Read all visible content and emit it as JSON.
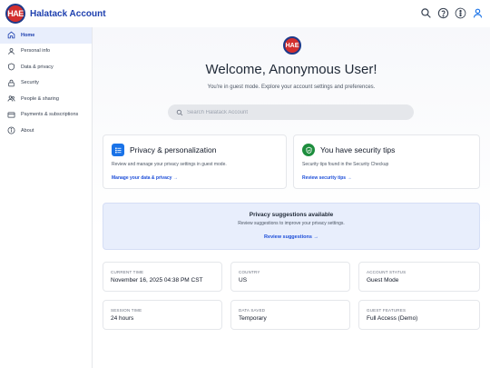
{
  "app": {
    "logo_text": "HAE",
    "name": "Halatack Account"
  },
  "header": {
    "icons": [
      "search-icon",
      "help-icon",
      "more-vert-icon",
      "account-icon"
    ]
  },
  "sidebar": {
    "items": [
      {
        "label": "Home",
        "icon": "home-icon",
        "active": true
      },
      {
        "label": "Personal info",
        "icon": "person-icon"
      },
      {
        "label": "Data & privacy",
        "icon": "shield-icon"
      },
      {
        "label": "Security",
        "icon": "lock-icon"
      },
      {
        "label": "People & sharing",
        "icon": "people-icon"
      },
      {
        "label": "Payments & subscriptions",
        "icon": "card-icon"
      },
      {
        "label": "About",
        "icon": "info-icon"
      }
    ]
  },
  "main": {
    "logo_text": "HAE",
    "welcome": "Welcome, Anonymous User!",
    "subtitle": "You're in guest mode. Explore your account settings and preferences.",
    "search_placeholder": "Search Halatack Account",
    "cards": [
      {
        "title": "Privacy & personalization",
        "desc": "Review and manage your privacy settings in guest mode.",
        "link": "Manage your data & privacy →",
        "icon": "privacy-icon",
        "color": "#1a73e8"
      },
      {
        "title": "You have security tips",
        "desc": "Security tips found in the Security Checkup",
        "link": "Review security tips →",
        "icon": "security-check-icon",
        "color": "#1e8e3e"
      }
    ],
    "suggestions": {
      "title": "Privacy suggestions available",
      "desc": "Review suggestions to improve your privacy settings.",
      "link": "Review suggestions →"
    },
    "info": [
      {
        "label": "CURRENT TIME",
        "value": "November 16, 2025 04:38 PM CST"
      },
      {
        "label": "COUNTRY",
        "value": "US"
      },
      {
        "label": "ACCOUNT STATUS",
        "value": "Guest Mode"
      },
      {
        "label": "SESSION TIME",
        "value": "24 hours"
      },
      {
        "label": "DATA SAVED",
        "value": "Temporary"
      },
      {
        "label": "GUEST FEATURES",
        "value": "Full Access (Demo)"
      }
    ]
  }
}
